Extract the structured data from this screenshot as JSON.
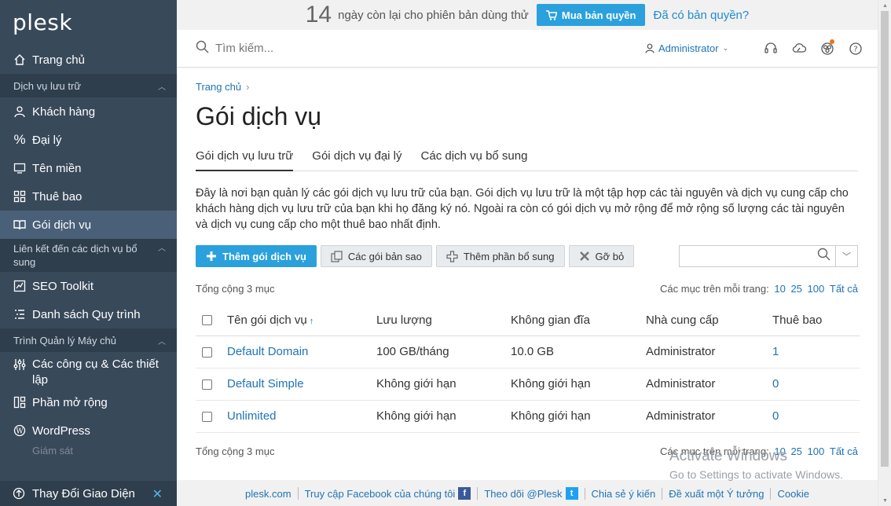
{
  "sidebar": {
    "logo": "plesk",
    "home": "Trang chủ",
    "sections": {
      "hosting": "Dịch vụ lưu trữ",
      "links": "Liên kết đến các dịch vụ bổ sung",
      "server": "Trình Quản lý Máy chủ"
    },
    "items": {
      "customers": "Khách hàng",
      "resellers": "Đại lý",
      "domains": "Tên miền",
      "subscriptions": "Thuê bao",
      "service_plans": "Gói dịch vụ",
      "seo": "SEO Toolkit",
      "workflows": "Danh sách Quy trình",
      "tools": "Các công cụ & Các thiết lập",
      "extensions": "Phần mở rộng",
      "wordpress": "WordPress",
      "partial": "Giám sát"
    },
    "bottom": "Thay Đổi Giao Diện"
  },
  "trial": {
    "days": "14",
    "message": "ngày còn lại cho phiên bản dùng thử",
    "buy_label": "Mua bản quyền",
    "have_label": "Đã có bản quyền?"
  },
  "topbar": {
    "search_placeholder": "Tìm kiếm...",
    "user": "Administrator"
  },
  "main": {
    "breadcrumb": "Trang chủ",
    "title": "Gói dịch vụ",
    "tabs": [
      "Gói dịch vụ lưu trữ",
      "Gói dịch vụ đại lý",
      "Các dịch vụ bổ sung"
    ],
    "description": "Đây là nơi bạn quản lý các gói dịch vụ lưu trữ của bạn. Gói dịch vụ lưu trữ là một tập hợp các tài nguyên và dịch vụ cung cấp cho khách hàng dịch vụ lưu trữ của bạn khi họ đăng ký nó. Ngoài ra còn có gói dịch vụ mở rộng để mở rộng số lượng các tài nguyên và dịch vụ cung cấp cho một thuê bao nhất định.",
    "toolbar": {
      "add": "Thêm gói dịch vụ",
      "copies": "Các gói bản sao",
      "addon": "Thêm phần bổ sung",
      "remove": "Gỡ bỏ"
    },
    "total": "Tổng cộng 3 mục",
    "per_page_label": "Các mục trên mỗi trang:",
    "per_page_options": [
      "10",
      "25",
      "100",
      "Tất cả"
    ],
    "columns": [
      "Tên gói dịch vụ",
      "Lưu lượng",
      "Không gian đĩa",
      "Nhà cung cấp",
      "Thuê bao"
    ],
    "rows": [
      {
        "name": "Default Domain",
        "traffic": "100 GB/tháng",
        "disk": "10.0 GB",
        "provider": "Administrator",
        "subs": "1"
      },
      {
        "name": "Default Simple",
        "traffic": "Không giới hạn",
        "disk": "Không giới hạn",
        "provider": "Administrator",
        "subs": "0"
      },
      {
        "name": "Unlimited",
        "traffic": "Không giới hạn",
        "disk": "Không giới hạn",
        "provider": "Administrator",
        "subs": "0"
      }
    ]
  },
  "footer": {
    "links": [
      "plesk.com",
      "Truy cập Facebook của chúng tôi",
      "Theo dõi @Plesk",
      "Chia sẻ ý kiến",
      "Đề xuất một Ý tưởng",
      "Cookie"
    ]
  },
  "watermark": {
    "line1": "Activate Windows",
    "line2": "Go to Settings to activate Windows."
  },
  "colors": {
    "sidebar": "#38495a",
    "accent": "#2aa1dd",
    "link": "#1f74b6"
  }
}
